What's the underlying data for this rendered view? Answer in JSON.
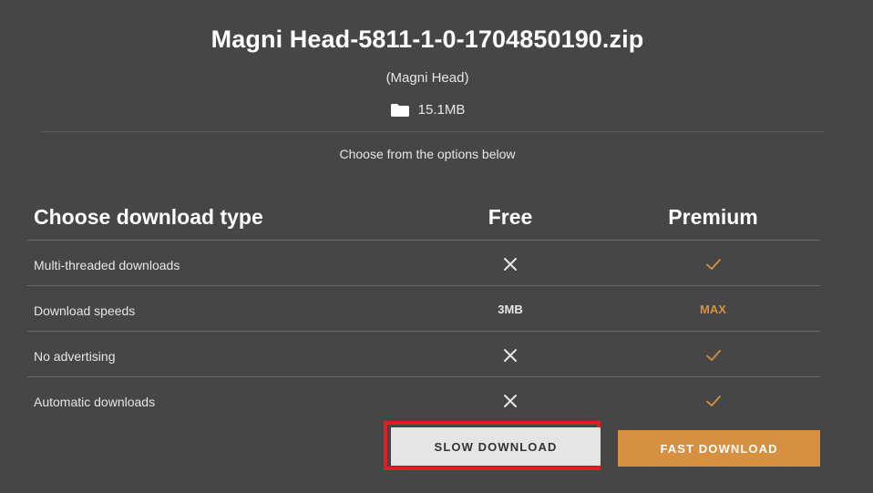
{
  "file": {
    "title": "Magni Head-5811-1-0-1704850190.zip",
    "subtitle": "(Magni Head)",
    "size": "15.1MB",
    "size_icon": "folder-icon"
  },
  "instructions": "Choose from the options below",
  "comparison": {
    "header": {
      "label": "Choose download type",
      "free": "Free",
      "premium": "Premium"
    },
    "rows": [
      {
        "label": "Multi-threaded downloads",
        "free": "no",
        "premium": "yes"
      },
      {
        "label": "Download speeds",
        "free": "3MB",
        "premium": "MAX"
      },
      {
        "label": "No advertising",
        "free": "no",
        "premium": "yes"
      },
      {
        "label": "Automatic downloads",
        "free": "no",
        "premium": "yes"
      }
    ]
  },
  "buttons": {
    "slow": "SLOW DOWNLOAD",
    "fast": "FAST DOWNLOAD"
  },
  "colors": {
    "background": "#464646",
    "accent": "#d6903f",
    "highlight": "#e31b23"
  }
}
